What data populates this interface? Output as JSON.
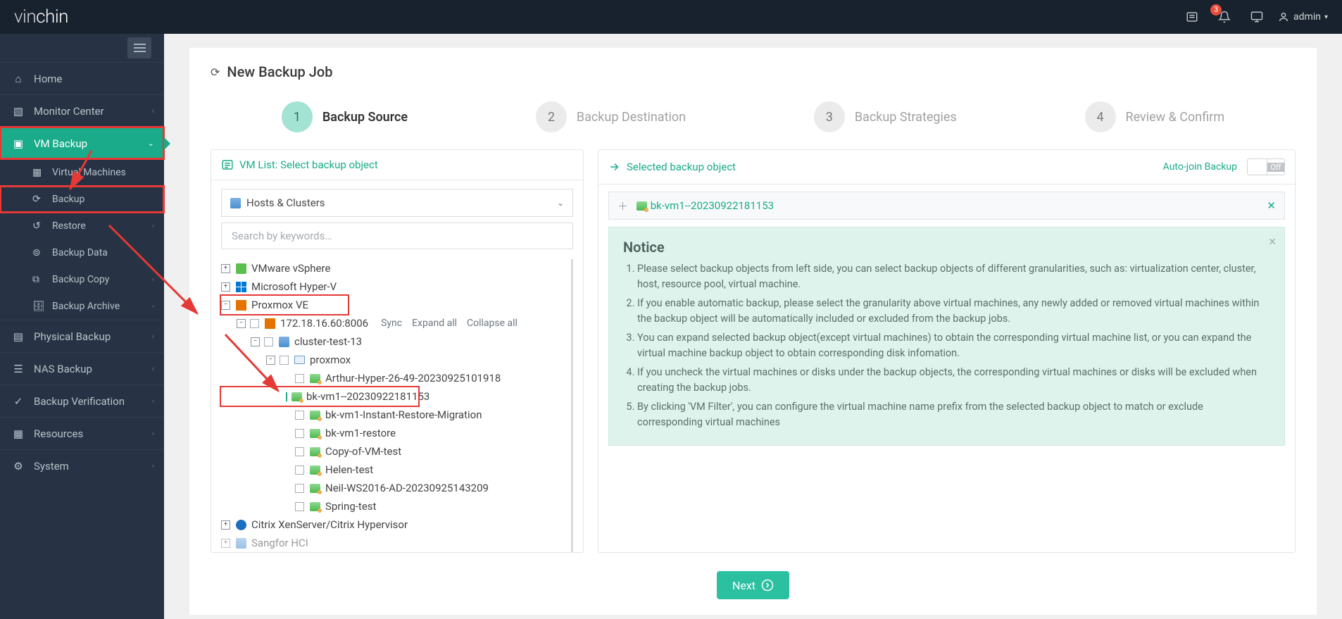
{
  "logo": {
    "part1": "vin",
    "part2": "chin"
  },
  "topbar": {
    "notif_count": "3",
    "user": "admin"
  },
  "sidebar": {
    "items": [
      {
        "label": "Home"
      },
      {
        "label": "Monitor Center"
      },
      {
        "label": "VM Backup",
        "active": true,
        "sub": [
          {
            "label": "Virtual Machines"
          },
          {
            "label": "Backup"
          },
          {
            "label": "Restore"
          },
          {
            "label": "Backup Data"
          },
          {
            "label": "Backup Copy"
          },
          {
            "label": "Backup Archive"
          }
        ]
      },
      {
        "label": "Physical Backup"
      },
      {
        "label": "NAS Backup"
      },
      {
        "label": "Backup Verification"
      },
      {
        "label": "Resources"
      },
      {
        "label": "System"
      }
    ]
  },
  "page": {
    "title": "New Backup Job"
  },
  "wizard": [
    {
      "num": "1",
      "label": "Backup Source",
      "active": true
    },
    {
      "num": "2",
      "label": "Backup Destination"
    },
    {
      "num": "3",
      "label": "Backup Strategies"
    },
    {
      "num": "4",
      "label": "Review & Confirm"
    }
  ],
  "left_panel": {
    "title": "VM List: Select backup object",
    "scope": "Hosts & Clusters",
    "search_placeholder": "Search by keywords…",
    "actions": {
      "sync": "Sync",
      "expand": "Expand all",
      "collapse": "Collapse all"
    },
    "platforms": {
      "vmware": "VMware vSphere",
      "hyperv": "Microsoft Hyper-V",
      "proxmox": "Proxmox VE",
      "xen": "Citrix XenServer/Citrix Hypervisor",
      "sangfor": "Sangfor HCI"
    },
    "proxmox_host": "172.18.16.60:8006",
    "cluster": "cluster-test-13",
    "node": "proxmox",
    "vms": [
      "Arthur-Hyper-26-49-20230925101918",
      "bk-vm1--20230922181153",
      "bk-vm1-Instant-Restore-Migration",
      "bk-vm1-restore",
      "Copy-of-VM-test",
      "Helen-test",
      "Neil-WS2016-AD-20230925143209",
      "Spring-test"
    ]
  },
  "right_panel": {
    "title": "Selected backup object",
    "autojoin_label": "Auto-join Backup",
    "toggle_off": "Off",
    "selected_vm": "bk-vm1--20230922181153",
    "notice_title": "Notice",
    "notice_items": [
      "Please select backup objects from left side, you can select backup objects of different granularities, such as: virtualization center, cluster, host, resource pool, virtual machine.",
      "If you enable automatic backup, please select the granularity above virtual machines, any newly added or removed virtual machines within the backup object will be automatically included or excluded from the backup jobs.",
      "You can expand selected backup object(except virtual machines) to obtain the corresponding virtual machine list, or you can expand the virtual machine backup object to obtain corresponding disk infomation.",
      "If you uncheck the virtual machines or disks under the backup objects, the corresponding virtual machines or disks will be excluded when creating the backup jobs.",
      "By clicking 'VM Filter', you can configure the virtual machine name prefix from the selected backup object to match or exclude corresponding virtual machines"
    ]
  },
  "footer": {
    "next": "Next"
  }
}
